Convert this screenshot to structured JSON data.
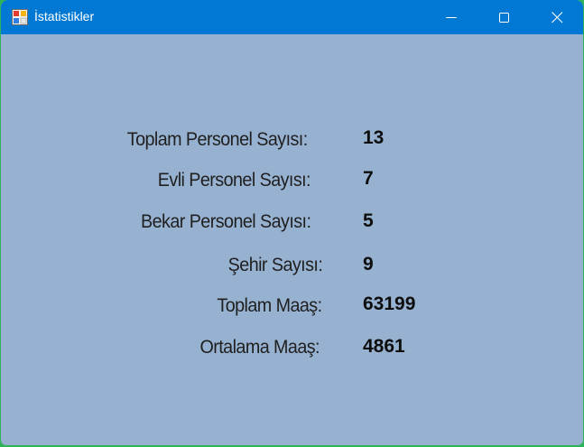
{
  "window": {
    "title": "İstatistikler",
    "controls": {
      "minimize_icon": "minimize-icon",
      "maximize_icon": "maximize-icon",
      "close_icon": "close-icon"
    },
    "colors": {
      "titlebar": "#0078d4",
      "client_background": "#97b2d1"
    }
  },
  "stats": {
    "toplam_personel": {
      "label": "Toplam Personel Sayısı:",
      "value": "13"
    },
    "evli_personel": {
      "label": "Evli Personel Sayısı:",
      "value": "7"
    },
    "bekar_personel": {
      "label": "Bekar Personel Sayısı:",
      "value": "5"
    },
    "sehir": {
      "label": "Şehir Sayısı:",
      "value": "9"
    },
    "toplam_maas": {
      "label": "Toplam Maaş:",
      "value": "63199"
    },
    "ortalama_maas": {
      "label": "Ortalama Maaş:",
      "value": "4861"
    }
  }
}
